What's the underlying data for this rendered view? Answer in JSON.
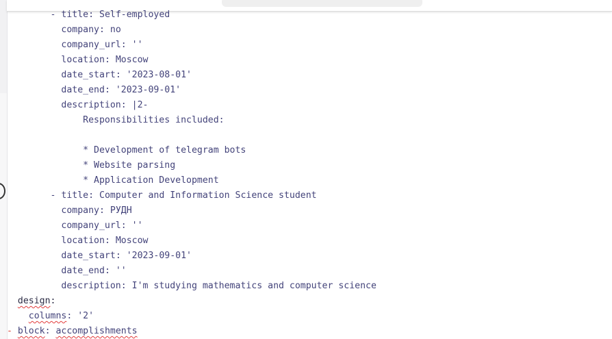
{
  "editor": {
    "lines": [
      {
        "indent": "        ",
        "dash": "- ",
        "key": "title",
        "sep": ": ",
        "value": "Self-employed"
      },
      {
        "indent": "          ",
        "dash": "",
        "key": "company",
        "sep": ": ",
        "value": "no"
      },
      {
        "indent": "          ",
        "dash": "",
        "key": "company_url",
        "sep": ": ",
        "value": "''"
      },
      {
        "indent": "          ",
        "dash": "",
        "key": "location",
        "sep": ": ",
        "value": "Moscow"
      },
      {
        "indent": "          ",
        "dash": "",
        "key": "date_start",
        "sep": ": ",
        "value": "'2023-08-01'"
      },
      {
        "indent": "          ",
        "dash": "",
        "key": "date_end",
        "sep": ": ",
        "value": "'2023-09-01'"
      },
      {
        "indent": "          ",
        "dash": "",
        "key": "description",
        "sep": ": ",
        "value": "|2-"
      },
      {
        "indent": "              ",
        "dash": "",
        "key": "",
        "sep": "",
        "value": "Responsibilities included:"
      },
      {
        "indent": "",
        "dash": "",
        "key": "",
        "sep": "",
        "value": ""
      },
      {
        "indent": "              ",
        "dash": "",
        "key": "",
        "sep": "",
        "value": "* Development of telegram bots"
      },
      {
        "indent": "              ",
        "dash": "",
        "key": "",
        "sep": "",
        "value": "* Website parsing"
      },
      {
        "indent": "              ",
        "dash": "",
        "key": "",
        "sep": "",
        "value": "* Application Development"
      },
      {
        "indent": "        ",
        "dash": "- ",
        "key": "title",
        "sep": ": ",
        "value": "Computer and Information Science student"
      },
      {
        "indent": "          ",
        "dash": "",
        "key": "company",
        "sep": ": ",
        "value": "РУДН"
      },
      {
        "indent": "          ",
        "dash": "",
        "key": "company_url",
        "sep": ": ",
        "value": "''"
      },
      {
        "indent": "          ",
        "dash": "",
        "key": "location",
        "sep": ": ",
        "value": "Moscow"
      },
      {
        "indent": "          ",
        "dash": "",
        "key": "date_start",
        "sep": ": ",
        "value": "'2023-09-01'"
      },
      {
        "indent": "          ",
        "dash": "",
        "key": "date_end",
        "sep": ": ",
        "value": "''"
      },
      {
        "indent": "          ",
        "dash": "",
        "key": "description",
        "sep": ": ",
        "value": "I'm studying mathematics and computer science"
      }
    ],
    "design_key": "design",
    "design_colon": ":",
    "columns_key": "columns",
    "columns_value": ": '2'",
    "block_dash": "- ",
    "block_key": "block",
    "block_value": "accomplishments"
  }
}
